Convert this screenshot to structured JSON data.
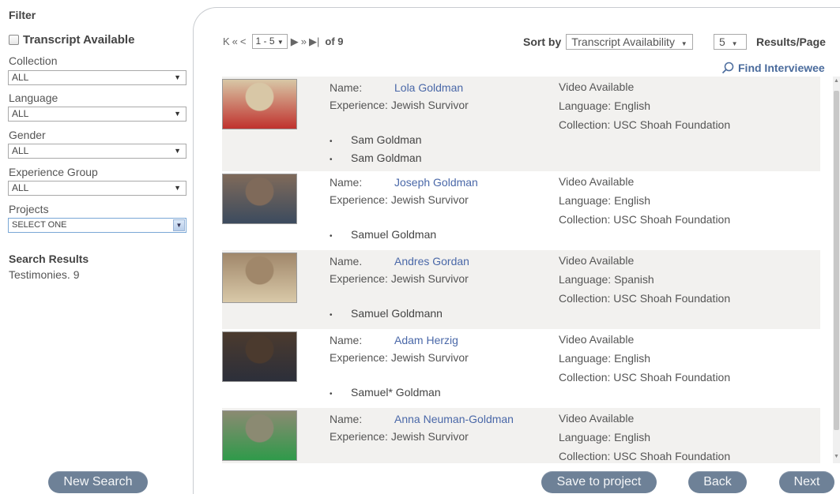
{
  "sidebar": {
    "title": "Filter",
    "transcript_label": "Transcript Available",
    "collection": {
      "label": "Collection",
      "value": "ALL"
    },
    "language": {
      "label": "Language",
      "value": "ALL"
    },
    "gender": {
      "label": "Gender",
      "value": "ALL"
    },
    "experience": {
      "label": "Experience Group",
      "value": "ALL"
    },
    "projects": {
      "label": "Projects",
      "value": "SELECT ONE"
    },
    "search_results_title": "Search Results",
    "testimonies_count": "Testimonies. 9",
    "new_search_label": "New Search"
  },
  "pager": {
    "first": "K",
    "prev_fast": "«",
    "prev": "<",
    "range": "1 - 5",
    "next": "▶",
    "next_fast": "»",
    "last": "▶|",
    "of": "of 9"
  },
  "sort": {
    "label": "Sort by",
    "value": "Transcript Availability",
    "results_per_page": "5",
    "results_per_page_label": "Results/Page"
  },
  "find_label": "Find Interviewee",
  "results": [
    {
      "name_key": "Name:",
      "name": "Lola Goldman",
      "experience": "Experience: Jewish Survivor",
      "video": "Video Available",
      "language": "Language: English",
      "collection": "Collection: USC Shoah Foundation",
      "related": [
        "Sam Goldman",
        "Sam Goldman"
      ],
      "thumb_colors": [
        "#d8c7a6",
        "#c0322e"
      ]
    },
    {
      "name_key": "Name:",
      "name": "Joseph Goldman",
      "experience": "Experience: Jewish Survivor",
      "video": "Video Available",
      "language": "Language: English",
      "collection": "Collection: USC Shoah Foundation",
      "related": [
        "Samuel Goldman"
      ],
      "thumb_colors": [
        "#7f6a5a",
        "#3c4b5e"
      ]
    },
    {
      "name_key": "Name.",
      "name": "Andres Gordan",
      "experience": "Experience: Jewish Survivor",
      "video": "Video Available",
      "language": "Language: Spanish",
      "collection": "Collection: USC Shoah Foundation",
      "related": [
        "Samuel Goldmann"
      ],
      "thumb_colors": [
        "#a0876a",
        "#d9c9a8"
      ]
    },
    {
      "name_key": "Name:",
      "name": "Adam Herzig",
      "experience": "Experience: Jewish Survivor",
      "video": "Video Available",
      "language": "Language: English",
      "collection": "Collection: USC Shoah Foundation",
      "related": [
        "Samuel* Goldman"
      ],
      "thumb_colors": [
        "#4b3a2e",
        "#2c2f3a"
      ]
    },
    {
      "name_key": "Name:",
      "name": "Anna Neuman-Goldman",
      "experience": "Experience: Jewish Survivor",
      "video": "Video Available",
      "language": "Language: English",
      "collection": "Collection: USC Shoah Foundation",
      "related": [],
      "thumb_colors": [
        "#8b8a72",
        "#2f9a4a"
      ]
    }
  ],
  "buttons": {
    "save": "Save to project",
    "back": "Back",
    "next": "Next"
  },
  "colors": {
    "pill": "#6e8197",
    "link": "#4a68a8",
    "row_shade": "#f2f1ef"
  }
}
